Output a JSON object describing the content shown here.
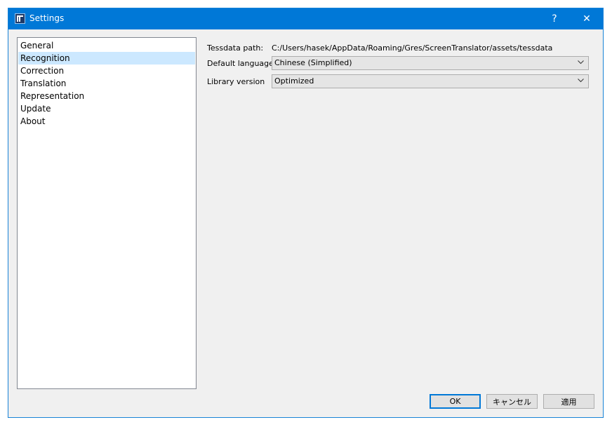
{
  "window": {
    "title": "Settings",
    "help_glyph": "?",
    "close_glyph": "✕"
  },
  "sidebar": {
    "items": [
      {
        "label": "General",
        "selected": false
      },
      {
        "label": "Recognition",
        "selected": true
      },
      {
        "label": "Correction",
        "selected": false
      },
      {
        "label": "Translation",
        "selected": false
      },
      {
        "label": "Representation",
        "selected": false
      },
      {
        "label": "Update",
        "selected": false
      },
      {
        "label": "About",
        "selected": false
      }
    ]
  },
  "recognition": {
    "tessdata_label": "Tessdata path:",
    "tessdata_value": "C:/Users/hasek/AppData/Roaming/Gres/ScreenTranslator/assets/tessdata",
    "language_label": "Default language:",
    "language_value": "Chinese (Simplified)",
    "library_label": "Library version",
    "library_value": "Optimized"
  },
  "buttons": {
    "ok": "OK",
    "cancel": "キャンセル",
    "apply": "適用"
  },
  "colors": {
    "title_bar": "#0078d7",
    "selection": "#cce8ff",
    "background": "#f0f0f0"
  }
}
